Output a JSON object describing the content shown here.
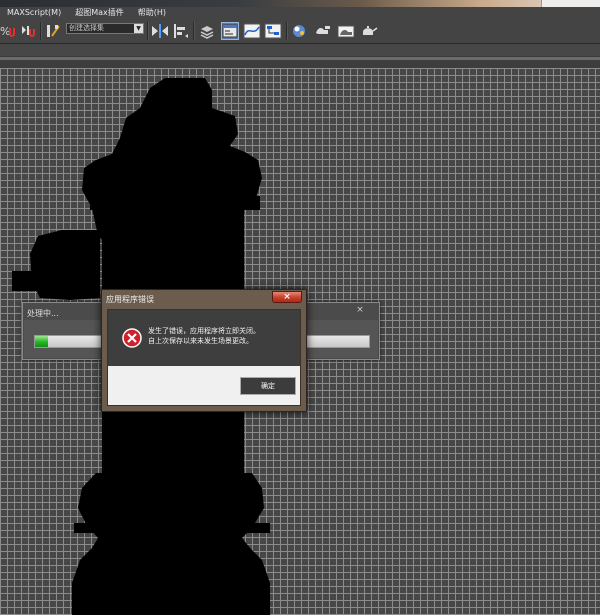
{
  "menu": {
    "items": [
      "MAXScript(M)",
      "超图Max插件",
      "帮助(H)"
    ]
  },
  "toolbar": {
    "selection_set": "创建选择集",
    "icons": [
      "percent-snap-icon",
      "spinner-snap-icon",
      "edit-named-selection-icon",
      "selection-set-dropdown",
      "mirror-icon",
      "align-icon",
      "layer-manager-icon",
      "scene-explorer-icon",
      "curve-editor-icon",
      "schematic-view-icon",
      "material-editor-icon",
      "render-setup-icon",
      "rendered-frame-icon",
      "render-icon",
      "render-teapot-icon"
    ]
  },
  "processing_dialog": {
    "title": "处理中...",
    "close_label": "×",
    "progress": 0.04
  },
  "error_dialog": {
    "title": "应用程序错误",
    "close_label": "×",
    "message_line1": "发生了错误，应用程序将立即关闭。",
    "message_line2": "自上次保存以来未发生场景更改。",
    "ok_label": "确定"
  },
  "colors": {
    "grid": "#8c8c8c",
    "viewport_bg": "#474747",
    "silhouette": "#000000",
    "progress_fill": "#22b522",
    "error_icon": "#d0202a",
    "close_button": "#c4402b"
  }
}
